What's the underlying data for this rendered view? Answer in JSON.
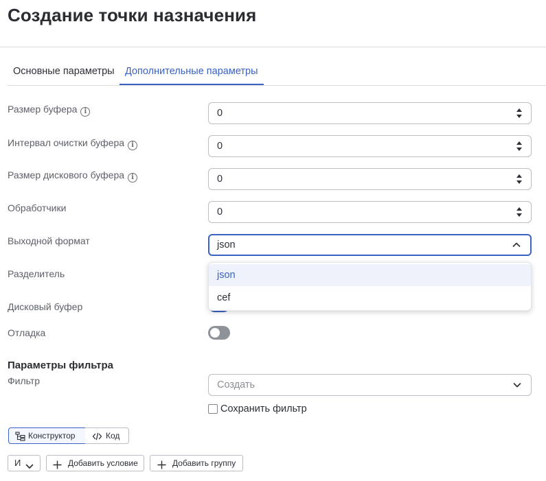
{
  "page": {
    "title": "Создание точки назначения"
  },
  "tabs": [
    {
      "label": "Основные параметры",
      "active": false
    },
    {
      "label": "Дополнительные параметры",
      "active": true
    }
  ],
  "fields": {
    "buffer_size": {
      "label": "Размер буфера",
      "value": "0"
    },
    "flush_interval": {
      "label": "Интервал очистки буфера",
      "value": "0"
    },
    "disk_buffer_size": {
      "label": "Размер дискового буфера",
      "value": "0"
    },
    "handlers": {
      "label": "Обработчики",
      "value": "0"
    },
    "output_format": {
      "label": "Выходной формат",
      "value": "json",
      "options": [
        "json",
        "cef"
      ]
    },
    "delimiter": {
      "label": "Разделитель"
    },
    "disk_buffer": {
      "label": "Дисковый буфер",
      "enabled": true
    },
    "debug": {
      "label": "Отладка",
      "enabled": false
    }
  },
  "filter": {
    "section_title": "Параметры фильтра",
    "label": "Фильтр",
    "placeholder": "Создать",
    "save_label": "Сохранить фильтр",
    "save_checked": false,
    "modes": [
      {
        "label": "Конструктор",
        "active": true
      },
      {
        "label": "Код",
        "active": false
      }
    ],
    "logic_operator": "И",
    "add_condition": "Добавить условие",
    "add_group": "Добавить группу"
  },
  "colors": {
    "accent": "#3a62c4",
    "toggle_off": "#8e9299",
    "border": "#b9bdc4"
  }
}
